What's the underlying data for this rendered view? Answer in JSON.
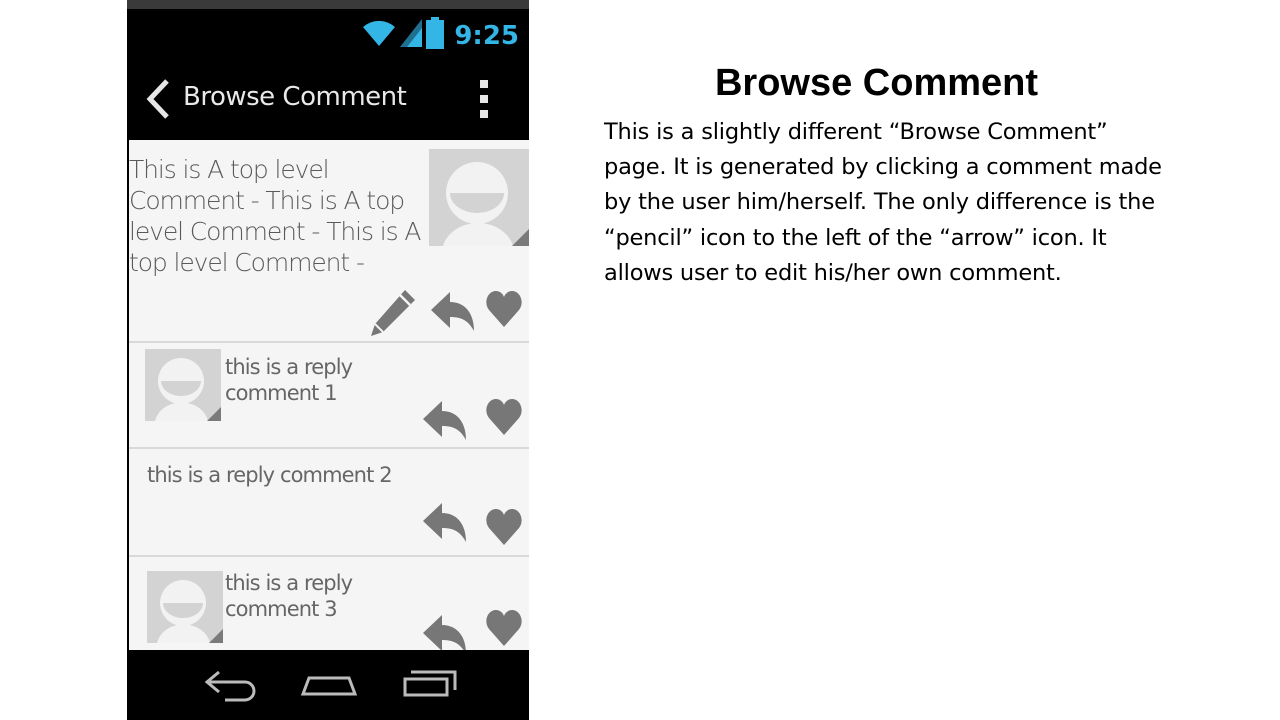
{
  "statusbar": {
    "time": "9:25"
  },
  "appbar": {
    "title": "Browse Comment"
  },
  "comments": {
    "top": {
      "text": "This is A top level Comment - This is A top level Comment - This is A top level Comment -"
    },
    "reply1": {
      "text": "this is a reply comment 1"
    },
    "reply2": {
      "text": "this is a reply comment 2"
    },
    "reply3": {
      "text": "this is a reply comment 3"
    }
  },
  "description": {
    "title": "Browse Comment",
    "body": "This is a slightly different “Browse Comment” page. It is generated by clicking a comment made by the user him/herself. The only difference is the “pencil” icon to the left of the “arrow” icon. It allows user to edit his/her own comment."
  },
  "icons": {
    "wifi": "wifi-icon",
    "signal": "signal-icon",
    "battery": "battery-icon",
    "back": "chevron-left-icon",
    "overflow": "overflow-menu-icon",
    "edit": "pencil-icon",
    "reply": "reply-arrow-icon",
    "like": "heart-icon",
    "nav_back": "nav-back-icon",
    "nav_home": "nav-home-icon",
    "nav_recents": "nav-recents-icon"
  },
  "colors": {
    "accent": "#33b5e5",
    "icon_gray": "#777777",
    "content_bg": "#f5f5f5"
  }
}
